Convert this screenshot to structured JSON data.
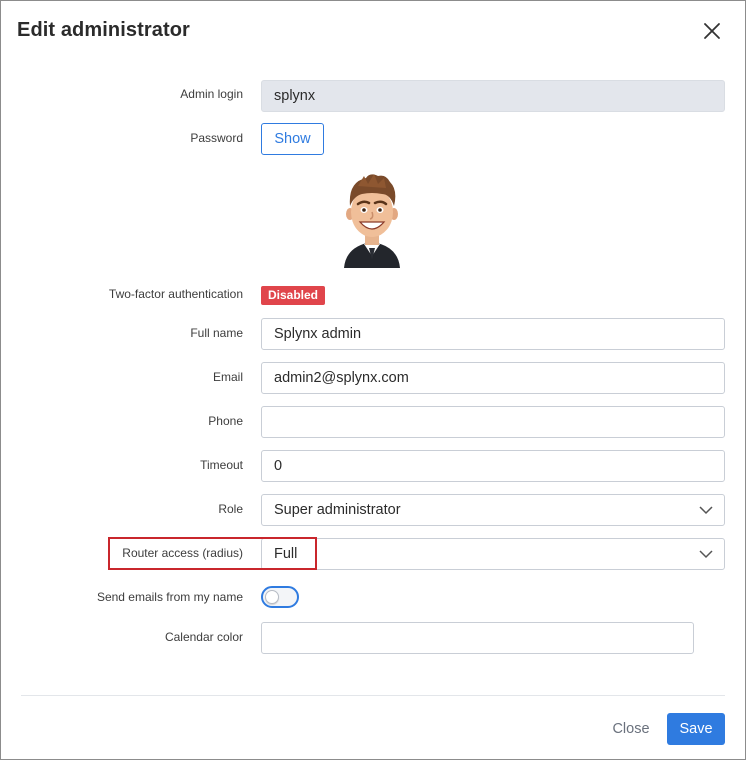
{
  "modal": {
    "title": "Edit administrator",
    "close_icon": "close-icon"
  },
  "form": {
    "admin_login": {
      "label": "Admin login",
      "value": "splynx"
    },
    "password": {
      "label": "Password",
      "button_label": "Show"
    },
    "avatar": {
      "icon": "avatar-cartoon-man"
    },
    "two_factor": {
      "label": "Two-factor authentication",
      "status": "Disabled",
      "status_color": "#e0454b"
    },
    "full_name": {
      "label": "Full name",
      "value": "Splynx admin"
    },
    "email": {
      "label": "Email",
      "value": "admin2@splynx.com"
    },
    "phone": {
      "label": "Phone",
      "value": ""
    },
    "timeout": {
      "label": "Timeout",
      "value": "0"
    },
    "role": {
      "label": "Role",
      "value": "Super administrator"
    },
    "router_access": {
      "label": "Router access (radius)",
      "value": "Full",
      "highlighted": true,
      "highlight_color": "#c9262c"
    },
    "send_emails": {
      "label": "Send emails from my name",
      "enabled": false
    },
    "calendar_color": {
      "label": "Calendar color",
      "value": ""
    }
  },
  "footer": {
    "close_label": "Close",
    "save_label": "Save",
    "accent_color": "#2f7be0"
  }
}
